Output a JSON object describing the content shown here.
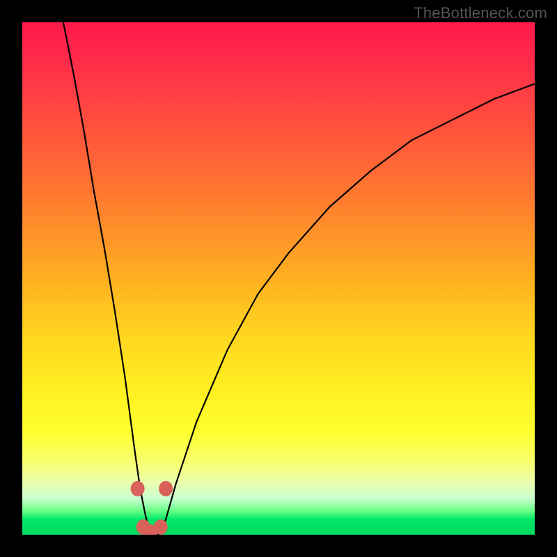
{
  "watermark": {
    "text": "TheBottleneck.com"
  },
  "colors": {
    "curve_stroke": "#000000",
    "marker_fill": "#d9605b",
    "marker_stroke": "#b8423c",
    "gradient_top": "#ff1a4a",
    "gradient_bottom": "#00d860"
  },
  "chart_data": {
    "type": "line",
    "title": "",
    "xlabel": "",
    "ylabel": "",
    "xlim": [
      0,
      100
    ],
    "ylim": [
      0,
      100
    ],
    "grid": false,
    "series": [
      {
        "name": "bottleneck-curve",
        "x": [
          8,
          10,
          12,
          14,
          16,
          18,
          20,
          22,
          23,
          24,
          25,
          26,
          27,
          28,
          30,
          34,
          40,
          46,
          52,
          60,
          68,
          76,
          84,
          92,
          100
        ],
        "values": [
          100,
          90,
          79,
          67,
          56,
          44,
          31,
          16,
          9,
          4,
          0,
          0,
          0,
          3,
          10,
          22,
          36,
          47,
          55,
          64,
          71,
          77,
          81,
          85,
          88
        ]
      }
    ],
    "markers": [
      {
        "x": 22.5,
        "y": 9
      },
      {
        "x": 28.0,
        "y": 9
      },
      {
        "x": 23.6,
        "y": 1.5
      },
      {
        "x": 25.0,
        "y": 0.5
      },
      {
        "x": 27.0,
        "y": 1.5
      }
    ]
  }
}
